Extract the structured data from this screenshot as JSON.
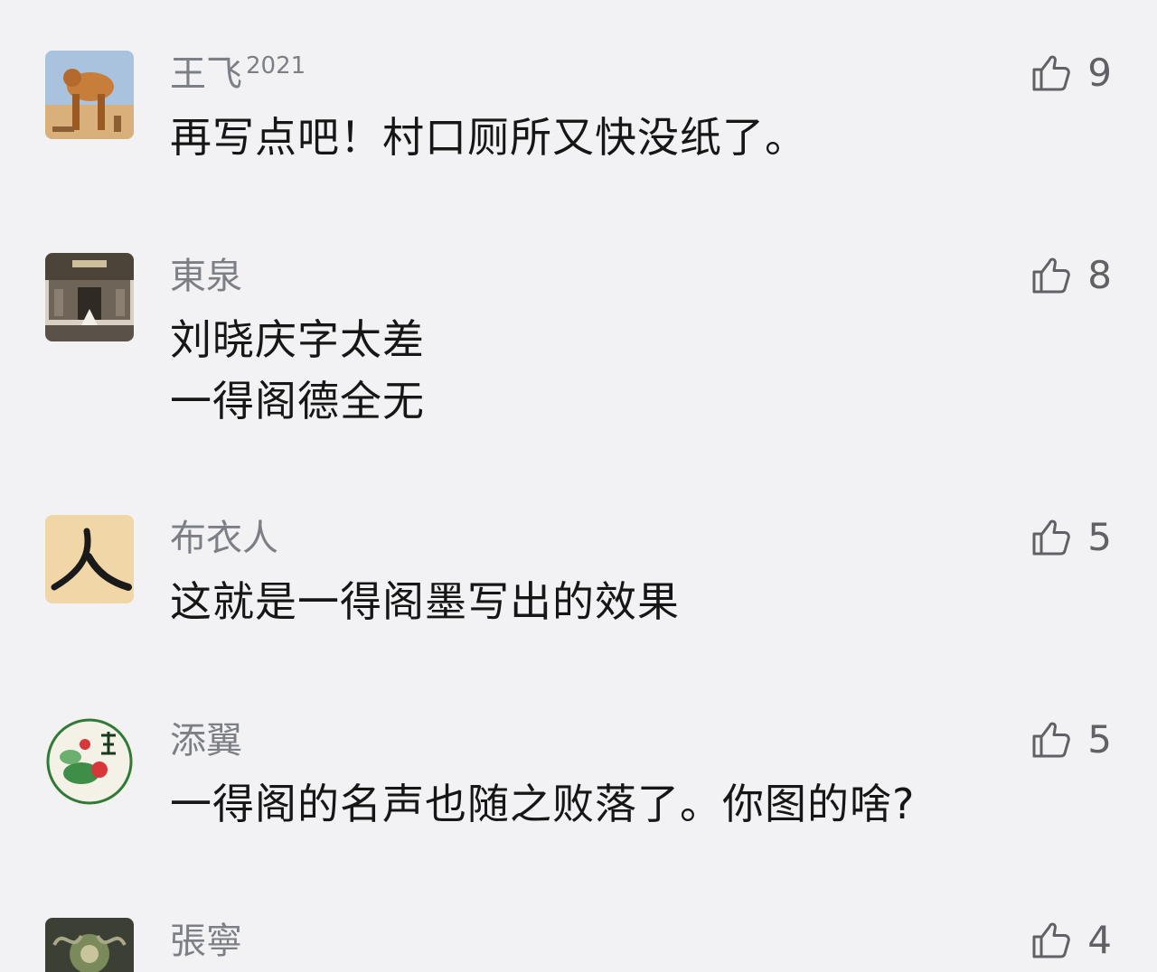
{
  "comments": [
    {
      "user": "王飞",
      "user_suffix": "2021",
      "text": "再写点吧！村口厕所又快没纸了。",
      "likes": "9",
      "avatar": "camel-sand-avatar"
    },
    {
      "user": "東泉",
      "user_suffix": "",
      "text": "刘晓庆字太差\n一得阁德全无",
      "likes": "8",
      "avatar": "temple-photo-avatar"
    },
    {
      "user": "布衣人",
      "user_suffix": "",
      "text": "这就是一得阁墨写出的效果",
      "likes": "5",
      "avatar": "ren-character-avatar"
    },
    {
      "user": "添翼",
      "user_suffix": "",
      "text": "一得阁的名声也随之败落了。你图的啥?",
      "likes": "5",
      "avatar": "lotus-painting-avatar"
    },
    {
      "user": "張寧",
      "user_suffix": "",
      "text": "",
      "likes": "4",
      "avatar": "ornament-avatar"
    }
  ],
  "colors": {
    "background": "#f2f2f4",
    "username": "#7c7f85",
    "text": "#161616",
    "like_icon": "#5f6166"
  },
  "icons": {
    "like": "thumbs-up-icon"
  }
}
